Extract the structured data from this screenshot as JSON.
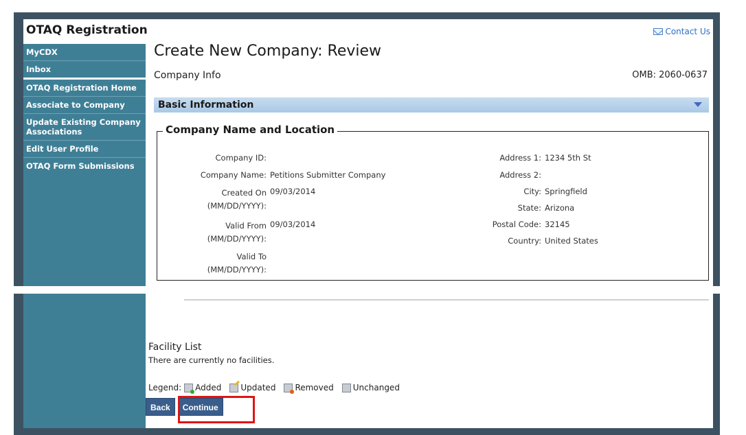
{
  "header": {
    "app_title": "OTAQ Registration",
    "contact_label": "Contact Us"
  },
  "sidebar": {
    "items": [
      {
        "label": "MyCDX"
      },
      {
        "label": "Inbox"
      },
      {
        "label": "OTAQ Registration Home"
      },
      {
        "label": "Associate to Company"
      },
      {
        "label": "Update Existing Company Associations"
      },
      {
        "label": "Edit User Profile"
      },
      {
        "label": "OTAQ Form Submissions"
      }
    ]
  },
  "page": {
    "title": "Create New Company: Review",
    "subtitle": "Company Info",
    "omb": "OMB: 2060-0637"
  },
  "basic_info": {
    "bar_label": "Basic Information",
    "fieldset_title": "Company Name and Location",
    "left_fields": [
      {
        "label": "Company ID:",
        "value": ""
      },
      {
        "label": "Company Name:",
        "value": "Petitions Submitter Company"
      },
      {
        "label": "Created On (MM/DD/YYYY):",
        "label_line1": "Created On",
        "label_line2": "(MM/DD/YYYY):",
        "value": "09/03/2014"
      },
      {
        "label": "Valid From (MM/DD/YYYY):",
        "label_line1": "Valid From",
        "label_line2": "(MM/DD/YYYY):",
        "value": "09/03/2014"
      },
      {
        "label": "Valid To (MM/DD/YYYY):",
        "label_line1": "Valid To",
        "label_line2": "(MM/DD/YYYY):",
        "value": ""
      }
    ],
    "right_fields": [
      {
        "label": "Address 1:",
        "value": "1234 5th St"
      },
      {
        "label": "Address 2:",
        "value": ""
      },
      {
        "label": "City:",
        "value": "Springfield"
      },
      {
        "label": "State:",
        "value": "Arizona"
      },
      {
        "label": "Postal Code:",
        "value": "32145"
      },
      {
        "label": "Country:",
        "value": "United States"
      }
    ]
  },
  "facility": {
    "title": "Facility List",
    "empty_text": "There are currently no facilities.",
    "legend_label": "Legend:",
    "legend_items": [
      "Added",
      "Updated",
      "Removed",
      "Unchanged"
    ]
  },
  "buttons": {
    "back": "Back",
    "continue": "Continue"
  },
  "colors": {
    "sidebar_bg": "#3f7f96",
    "frame": "#3c5262",
    "button_bg": "#3a5e8c",
    "highlight": "#e01414",
    "section_bar": "#a9c9e6"
  }
}
